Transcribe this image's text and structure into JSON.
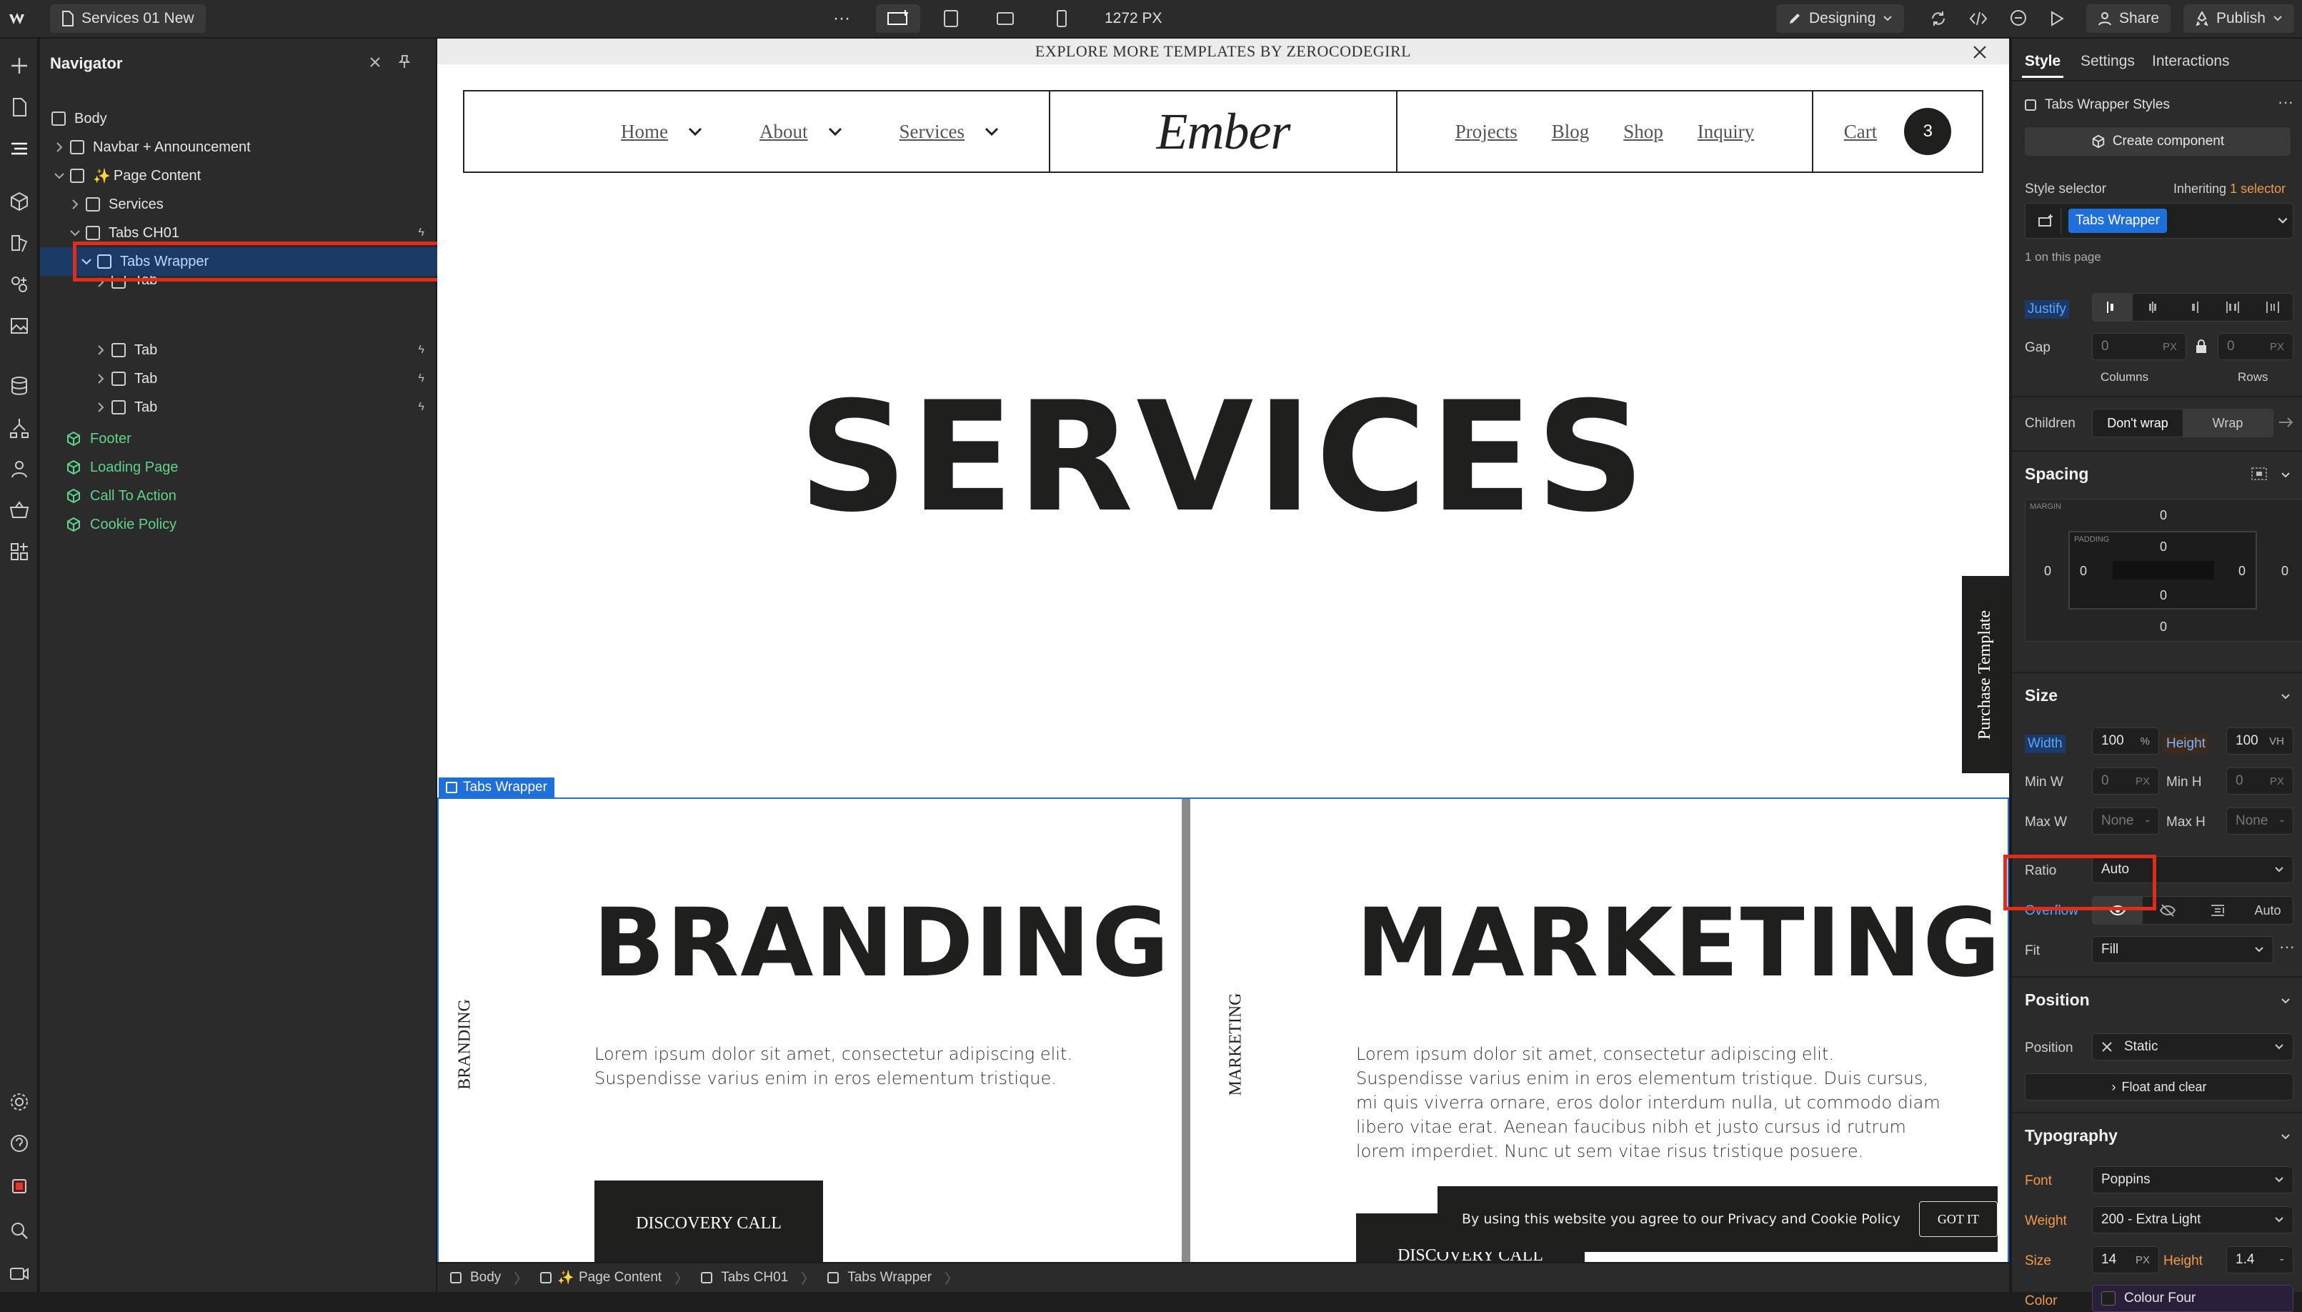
{
  "topbar": {
    "page_name": "Services 01 New",
    "more": "···",
    "viewport_width": "1272 PX",
    "mode": "Designing",
    "share": "Share",
    "publish": "Publish"
  },
  "navigator": {
    "title": "Navigator",
    "items": [
      {
        "label": "Body"
      },
      {
        "label": "Navbar + Announcement"
      },
      {
        "label": "Page Content"
      },
      {
        "label": "Services"
      },
      {
        "label": "Tabs CH01"
      },
      {
        "label": "Tabs Wrapper"
      },
      {
        "label": "Tab"
      },
      {
        "label": "Tab"
      },
      {
        "label": "Tab"
      },
      {
        "label": "Tab"
      },
      {
        "label": "Footer"
      },
      {
        "label": "Loading Page"
      },
      {
        "label": "Call To Action"
      },
      {
        "label": "Cookie Policy"
      }
    ]
  },
  "canvas": {
    "announcement": "EXPLORE MORE TEMPLATES BY ZEROCODEGIRL",
    "nav": {
      "home": "Home",
      "about": "About",
      "services": "Services",
      "logo": "Ember",
      "projects": "Projects",
      "blog": "Blog",
      "shop": "Shop",
      "inquiry": "Inquiry",
      "cart": "Cart",
      "cart_count": "3"
    },
    "hero_title": "SERVICES",
    "purchase_template": "Purchase Template",
    "selected_label": "Tabs Wrapper",
    "panels": [
      {
        "side_label": "BRANDING",
        "title": "BRANDING",
        "body": "Lorem ipsum dolor sit amet, consectetur adipiscing elit. Suspendisse varius enim in eros elementum tristique.",
        "button": "DISCOVERY CALL"
      },
      {
        "side_label": "MARKETING",
        "title": "MARKETING",
        "body": "Lorem ipsum dolor sit amet, consectetur adipiscing elit. Suspendisse varius enim in eros elementum tristique. Duis cursus, mi quis viverra ornare, eros dolor interdum nulla, ut commodo diam libero vitae erat. Aenean faucibus nibh et justo cursus id rutrum lorem imperdiet. Nunc ut sem vitae risus tristique posuere.",
        "button": "DISCOVERY CALL"
      }
    ],
    "cookie": {
      "text": "By using this website you agree to our Privacy and Cookie Policy",
      "button": "GOT IT"
    }
  },
  "breadcrumb": [
    "Body",
    "Page Content",
    "Tabs CH01",
    "Tabs Wrapper"
  ],
  "panel": {
    "tabs": [
      "Style",
      "Settings",
      "Interactions"
    ],
    "styles_label": "Tabs Wrapper Styles",
    "create_component": "Create component",
    "style_selector": "Style selector",
    "inheriting_prefix": "Inheriting",
    "inheriting_count": "1",
    "inheriting_suffix": "selector",
    "selector_chip": "Tabs Wrapper",
    "on_page": "1 on this page",
    "justify": "Justify",
    "gap": "Gap",
    "gap_columns": "0",
    "gap_rows": "0",
    "px": "PX",
    "columns": "Columns",
    "rows": "Rows",
    "children": "Children",
    "dont_wrap": "Don't wrap",
    "wrap": "Wrap",
    "spacing": "Spacing",
    "margin_label": "MARGIN",
    "padding_label": "PADDING",
    "zero": "0",
    "size": "Size",
    "width": "Width",
    "width_value": "100",
    "width_unit": "%",
    "height": "Height",
    "height_value": "100",
    "height_unit": "VH",
    "min_w": "Min W",
    "min_h": "Min H",
    "max_w": "Max W",
    "max_h": "Max H",
    "none": "None",
    "dash": "-",
    "ratio": "Ratio",
    "ratio_value": "Auto",
    "overflow": "Overflow",
    "overflow_auto": "Auto",
    "fit": "Fit",
    "fit_value": "Fill",
    "position_section": "Position",
    "position": "Position",
    "position_value": "Static",
    "float_clear": "Float and clear",
    "typography": "Typography",
    "font": "Font",
    "font_value": "Poppins",
    "weight": "Weight",
    "weight_value": "200 - Extra Light",
    "size_label": "Size",
    "size_value": "14",
    "line_height_label": "Height",
    "line_height_value": "1.4",
    "color": "Color",
    "color_value": "Colour Four",
    "colors": {
      "accent": "#1e6fd9",
      "annotation": "#e02d1b",
      "selected_row": "#1c3a66"
    }
  }
}
